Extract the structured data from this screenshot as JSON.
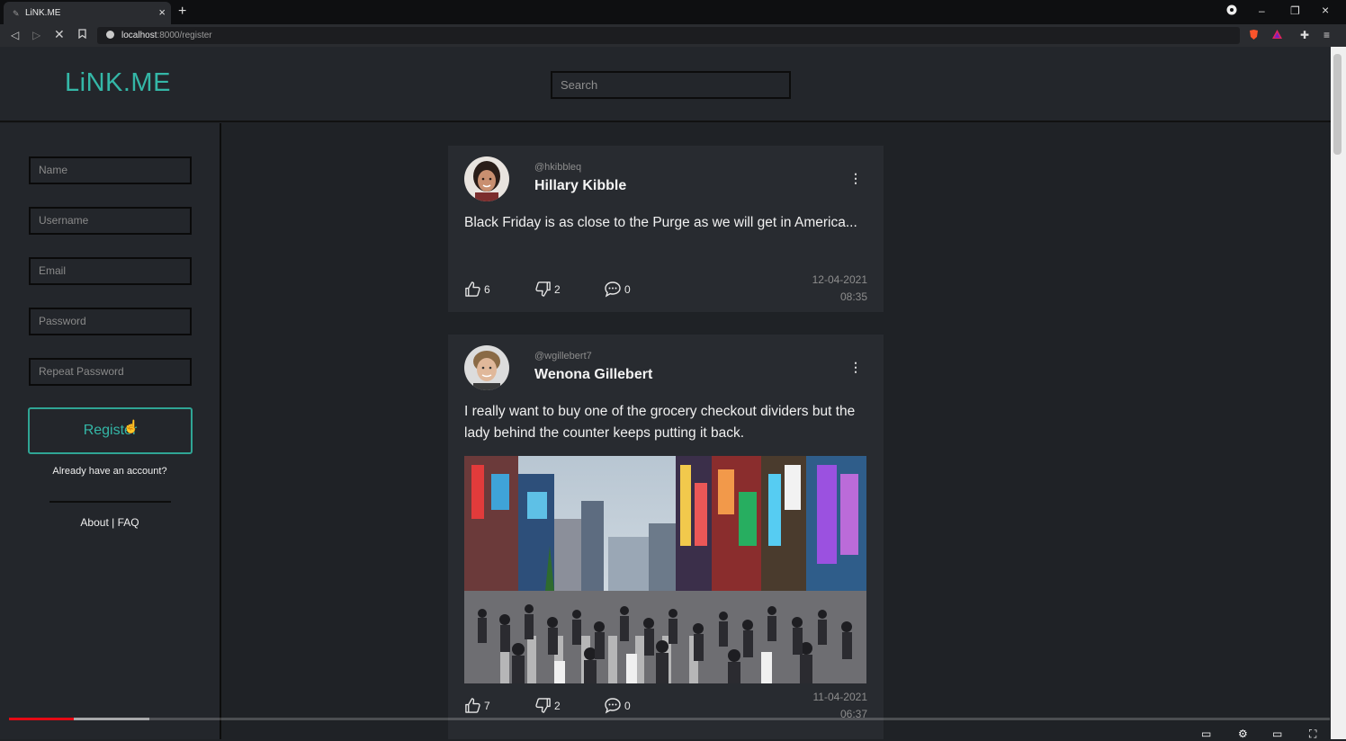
{
  "browser": {
    "tab_title": "LiNK.ME",
    "url_host": "localhost",
    "url_path": ":8000/register"
  },
  "header": {
    "logo": "LiNK.ME",
    "search_placeholder": "Search"
  },
  "sidebar": {
    "fields": [
      {
        "placeholder": "Name"
      },
      {
        "placeholder": "Username"
      },
      {
        "placeholder": "Email"
      },
      {
        "placeholder": "Password"
      },
      {
        "placeholder": "Repeat Password"
      }
    ],
    "register_label": "Register",
    "already_text": "Already have an account?",
    "about_text": "About | FAQ"
  },
  "posts": [
    {
      "handle": "@hkibbleq",
      "name": "Hillary Kibble",
      "text": "Black Friday is as close to the Purge as we will get in America...",
      "likes": "6",
      "dislikes": "2",
      "comments": "0",
      "date": "12-04-2021",
      "time": "08:35"
    },
    {
      "handle": "@wgillebert7",
      "name": "Wenona Gillebert",
      "text": "I really want to buy one of the grocery checkout dividers but the lady behind the counter keeps putting it back.",
      "likes": "7",
      "dislikes": "2",
      "comments": "0",
      "date": "11-04-2021",
      "time": "06:37"
    }
  ],
  "colors": {
    "accent": "#34b7a7",
    "background": "#1f2226",
    "card": "#282b30"
  },
  "video": {
    "played_fraction": 0.049,
    "loaded_fraction": 0.106
  }
}
